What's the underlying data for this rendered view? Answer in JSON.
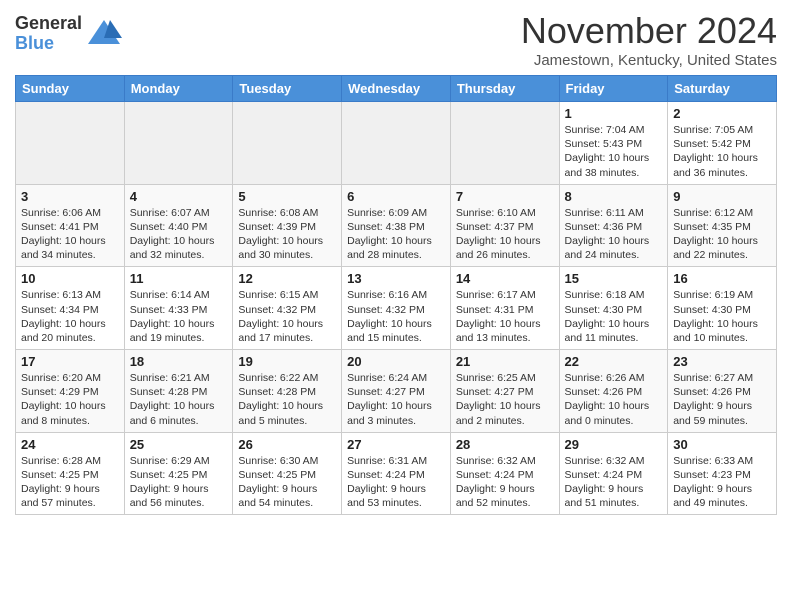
{
  "logo": {
    "general": "General",
    "blue": "Blue"
  },
  "header": {
    "month": "November 2024",
    "location": "Jamestown, Kentucky, United States"
  },
  "weekdays": [
    "Sunday",
    "Monday",
    "Tuesday",
    "Wednesday",
    "Thursday",
    "Friday",
    "Saturday"
  ],
  "weeks": [
    [
      {
        "day": "",
        "info": ""
      },
      {
        "day": "",
        "info": ""
      },
      {
        "day": "",
        "info": ""
      },
      {
        "day": "",
        "info": ""
      },
      {
        "day": "",
        "info": ""
      },
      {
        "day": "1",
        "info": "Sunrise: 7:04 AM\nSunset: 5:43 PM\nDaylight: 10 hours and 38 minutes."
      },
      {
        "day": "2",
        "info": "Sunrise: 7:05 AM\nSunset: 5:42 PM\nDaylight: 10 hours and 36 minutes."
      }
    ],
    [
      {
        "day": "3",
        "info": "Sunrise: 6:06 AM\nSunset: 4:41 PM\nDaylight: 10 hours and 34 minutes."
      },
      {
        "day": "4",
        "info": "Sunrise: 6:07 AM\nSunset: 4:40 PM\nDaylight: 10 hours and 32 minutes."
      },
      {
        "day": "5",
        "info": "Sunrise: 6:08 AM\nSunset: 4:39 PM\nDaylight: 10 hours and 30 minutes."
      },
      {
        "day": "6",
        "info": "Sunrise: 6:09 AM\nSunset: 4:38 PM\nDaylight: 10 hours and 28 minutes."
      },
      {
        "day": "7",
        "info": "Sunrise: 6:10 AM\nSunset: 4:37 PM\nDaylight: 10 hours and 26 minutes."
      },
      {
        "day": "8",
        "info": "Sunrise: 6:11 AM\nSunset: 4:36 PM\nDaylight: 10 hours and 24 minutes."
      },
      {
        "day": "9",
        "info": "Sunrise: 6:12 AM\nSunset: 4:35 PM\nDaylight: 10 hours and 22 minutes."
      }
    ],
    [
      {
        "day": "10",
        "info": "Sunrise: 6:13 AM\nSunset: 4:34 PM\nDaylight: 10 hours and 20 minutes."
      },
      {
        "day": "11",
        "info": "Sunrise: 6:14 AM\nSunset: 4:33 PM\nDaylight: 10 hours and 19 minutes."
      },
      {
        "day": "12",
        "info": "Sunrise: 6:15 AM\nSunset: 4:32 PM\nDaylight: 10 hours and 17 minutes."
      },
      {
        "day": "13",
        "info": "Sunrise: 6:16 AM\nSunset: 4:32 PM\nDaylight: 10 hours and 15 minutes."
      },
      {
        "day": "14",
        "info": "Sunrise: 6:17 AM\nSunset: 4:31 PM\nDaylight: 10 hours and 13 minutes."
      },
      {
        "day": "15",
        "info": "Sunrise: 6:18 AM\nSunset: 4:30 PM\nDaylight: 10 hours and 11 minutes."
      },
      {
        "day": "16",
        "info": "Sunrise: 6:19 AM\nSunset: 4:30 PM\nDaylight: 10 hours and 10 minutes."
      }
    ],
    [
      {
        "day": "17",
        "info": "Sunrise: 6:20 AM\nSunset: 4:29 PM\nDaylight: 10 hours and 8 minutes."
      },
      {
        "day": "18",
        "info": "Sunrise: 6:21 AM\nSunset: 4:28 PM\nDaylight: 10 hours and 6 minutes."
      },
      {
        "day": "19",
        "info": "Sunrise: 6:22 AM\nSunset: 4:28 PM\nDaylight: 10 hours and 5 minutes."
      },
      {
        "day": "20",
        "info": "Sunrise: 6:24 AM\nSunset: 4:27 PM\nDaylight: 10 hours and 3 minutes."
      },
      {
        "day": "21",
        "info": "Sunrise: 6:25 AM\nSunset: 4:27 PM\nDaylight: 10 hours and 2 minutes."
      },
      {
        "day": "22",
        "info": "Sunrise: 6:26 AM\nSunset: 4:26 PM\nDaylight: 10 hours and 0 minutes."
      },
      {
        "day": "23",
        "info": "Sunrise: 6:27 AM\nSunset: 4:26 PM\nDaylight: 9 hours and 59 minutes."
      }
    ],
    [
      {
        "day": "24",
        "info": "Sunrise: 6:28 AM\nSunset: 4:25 PM\nDaylight: 9 hours and 57 minutes."
      },
      {
        "day": "25",
        "info": "Sunrise: 6:29 AM\nSunset: 4:25 PM\nDaylight: 9 hours and 56 minutes."
      },
      {
        "day": "26",
        "info": "Sunrise: 6:30 AM\nSunset: 4:25 PM\nDaylight: 9 hours and 54 minutes."
      },
      {
        "day": "27",
        "info": "Sunrise: 6:31 AM\nSunset: 4:24 PM\nDaylight: 9 hours and 53 minutes."
      },
      {
        "day": "28",
        "info": "Sunrise: 6:32 AM\nSunset: 4:24 PM\nDaylight: 9 hours and 52 minutes."
      },
      {
        "day": "29",
        "info": "Sunrise: 6:32 AM\nSunset: 4:24 PM\nDaylight: 9 hours and 51 minutes."
      },
      {
        "day": "30",
        "info": "Sunrise: 6:33 AM\nSunset: 4:23 PM\nDaylight: 9 hours and 49 minutes."
      }
    ]
  ]
}
